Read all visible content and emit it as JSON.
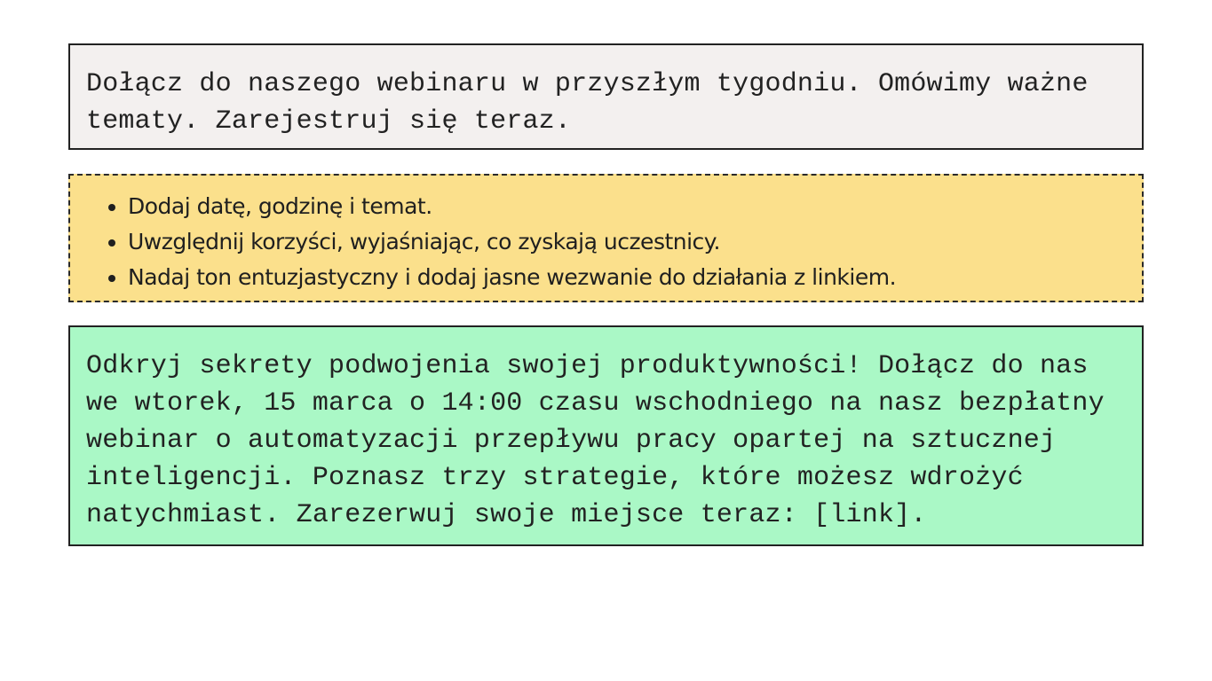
{
  "prompt": {
    "text": "Dołącz do naszego webinaru w przyszłym tygodniu. Omówimy ważne tematy. Zarejestruj się teraz."
  },
  "tips": {
    "items": [
      "Dodaj datę, godzinę i temat.",
      "Uwzględnij korzyści, wyjaśniając, co zyskają uczestnicy.",
      "Nadaj ton entuzjastyczny i dodaj jasne wezwanie do działania z linkiem."
    ]
  },
  "result": {
    "text": "Odkryj sekrety podwojenia swojej produktywności! Dołącz do nas we wtorek, 15 marca o 14:00 czasu wschodniego na nasz bezpłatny webinar o automatyzacji przepływu pracy opartej na sztucznej inteligencji. Poznasz trzy strategie, które możesz wdrożyć natychmiast. Zarezerwuj swoje miejsce teraz: [link]."
  },
  "colors": {
    "prompt_bg": "#f3f0ef",
    "tips_bg": "#fbe08c",
    "result_bg": "#aaf8c6",
    "border": "#222222"
  }
}
